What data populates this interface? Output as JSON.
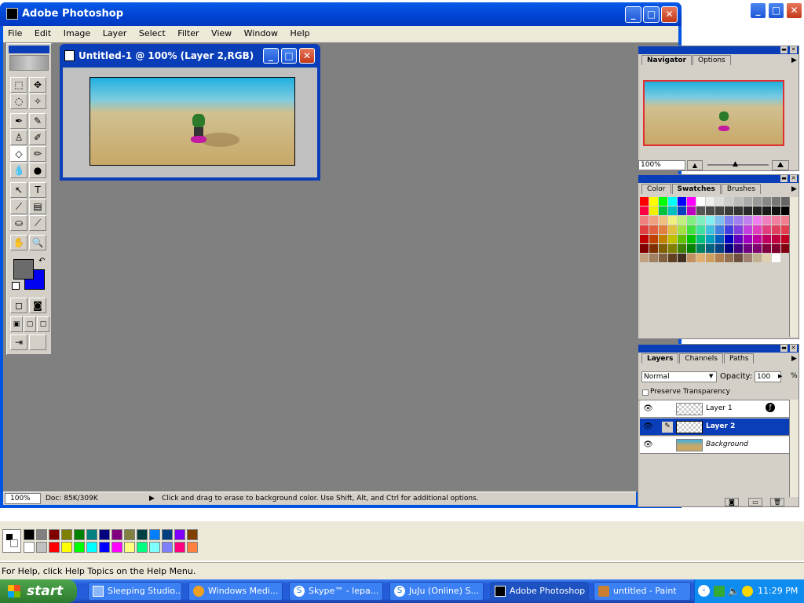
{
  "photoshop": {
    "title": "Adobe Photoshop",
    "menu": [
      "File",
      "Edit",
      "Image",
      "Layer",
      "Select",
      "Filter",
      "View",
      "Window",
      "Help"
    ],
    "status": {
      "zoom": "100%",
      "doc": "Doc: 85K/309K",
      "hint": "Click and drag to erase to background color.  Use Shift, Alt, and Ctrl for additional options."
    }
  },
  "image_window": {
    "title": "Untitled-1 @ 100% (Layer 2,RGB)"
  },
  "navigator": {
    "tabs": [
      "Navigator",
      "Options"
    ],
    "zoom": "100%"
  },
  "swatches_panel": {
    "tabs": [
      "Color",
      "Swatches",
      "Brushes"
    ]
  },
  "layers": {
    "tabs": [
      "Layers",
      "Channels",
      "Paths"
    ],
    "blend_mode": "Normal",
    "opacity_label": "Opacity:",
    "opacity_value": "100",
    "opacity_unit": "%",
    "preserve_label": "Preserve Transparency",
    "items": [
      {
        "name": "Layer 1",
        "selected": false
      },
      {
        "name": "Layer 2",
        "selected": true
      },
      {
        "name": "Background",
        "selected": false
      }
    ]
  },
  "paint": {
    "status": "For Help, click Help Topics on the Help Menu."
  },
  "taskbar": {
    "start": "start",
    "tasks": [
      {
        "label": "Sleeping Studio..."
      },
      {
        "label": "Windows Medi..."
      },
      {
        "label": "Skype™ - lepa..."
      },
      {
        "label": "JuJu (Online) S..."
      },
      {
        "label": "Adobe Photoshop"
      },
      {
        "label": "untitled - Paint"
      }
    ],
    "clock": "11:29 PM"
  },
  "colors": {
    "xp_blue": "#0054e3",
    "ps_panel": "#d4d0c8",
    "workspace": "#808080",
    "selected_layer": "#0a3eb8"
  }
}
